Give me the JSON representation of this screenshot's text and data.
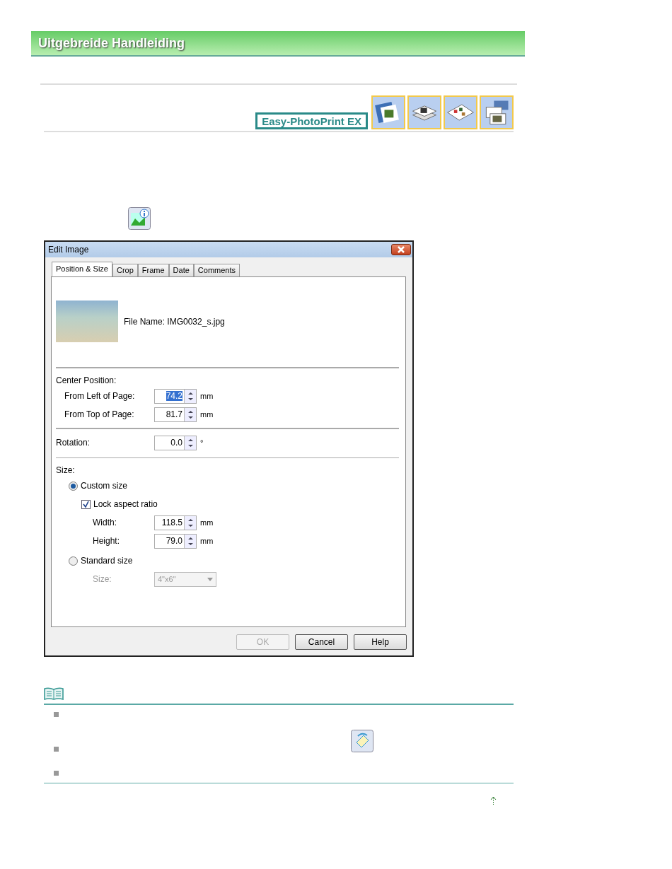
{
  "header": {
    "title": "Uitgebreide Handleiding"
  },
  "logo": {
    "text": "Easy-PhotoPrint EX"
  },
  "dialog": {
    "title": "Edit Image",
    "tabs": [
      {
        "label": "Position & Size",
        "selected": true
      },
      {
        "label": "Crop",
        "selected": false
      },
      {
        "label": "Frame",
        "selected": false
      },
      {
        "label": "Date",
        "selected": false
      },
      {
        "label": "Comments",
        "selected": false
      }
    ],
    "file_name": "File Name: IMG0032_s.jpg",
    "center_position": {
      "label": "Center Position:",
      "fields": [
        {
          "label": "From Left of Page:",
          "value": "74.2",
          "unit": "mm",
          "highlighted": true
        },
        {
          "label": "From Top of Page:",
          "value": "81.7",
          "unit": "mm",
          "highlighted": false
        }
      ]
    },
    "rotation": {
      "label": "Rotation:",
      "value": "0.0",
      "unit": "°"
    },
    "size": {
      "label": "Size:",
      "custom": {
        "label": "Custom size",
        "selected": true
      },
      "lock": {
        "label": "Lock aspect ratio",
        "checked": true
      },
      "fields": [
        {
          "label": "Width:",
          "value": "118.5",
          "unit": "mm"
        },
        {
          "label": "Height:",
          "value": "79.0",
          "unit": "mm"
        }
      ],
      "standard": {
        "label": "Standard size",
        "selected": false
      },
      "size_select": {
        "label": "Size:",
        "value": "4\"x6\"",
        "disabled": true
      }
    },
    "buttons": [
      {
        "label": "OK",
        "disabled": true
      },
      {
        "label": "Cancel",
        "disabled": false
      },
      {
        "label": "Help",
        "disabled": false
      }
    ]
  }
}
